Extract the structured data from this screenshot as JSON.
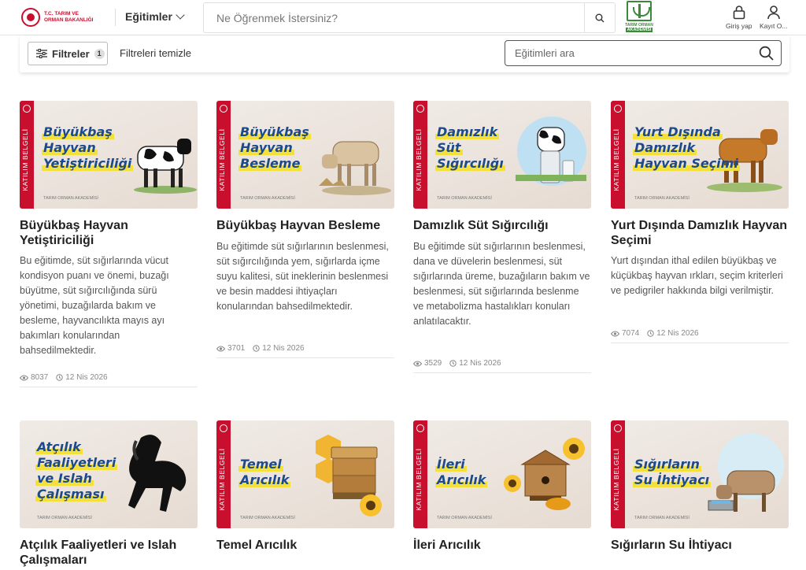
{
  "header": {
    "logo_text": "T.C. TARIM VE ORMAN BAKANLIĞI",
    "nav_label": "Eğitimler",
    "search_placeholder": "Ne Öğrenmek İstersiniz?",
    "akademi_line1": "TARIM ORMAN",
    "akademi_line2": "AKADEMİSİ",
    "login_label": "Giriş yap",
    "register_label": "Kayıt O..."
  },
  "filterbar": {
    "filter_label": "Filtreler",
    "filter_count": "1",
    "clear_label": "Filtreleri temizle",
    "search_placeholder": "Eğitimleri ara"
  },
  "thumb_common": {
    "ribbon": "KATILIM BELGELİ",
    "academy": "TARIM ORMAN AKADEMİSİ"
  },
  "cards": [
    {
      "thumb_lines": [
        "Büyükbaş",
        "Hayvan",
        "Yetiştiriciliği"
      ],
      "title": "Büyükbaş Hayvan Yetiştiriciliği",
      "description": "Bu eğitimde, süt sığırlarında vücut kondisyon puanı ve önemi, buzağı büyütme, süt sığırcılığında sürü yönetimi, buzağılarda bakım ve besleme, hayvancılıkta mayıs ayı bakımları konularından bahsedilmektedir.",
      "views": "8037",
      "date": "12 Nis 2026",
      "art": "cow-bw"
    },
    {
      "thumb_lines": [
        "Büyükbaş",
        "Hayvan",
        "Besleme"
      ],
      "title": "Büyükbaş Hayvan Besleme",
      "description": "Bu eğitimde süt sığırlarının beslenmesi, süt sığırcılığında yem, sığırlarda içme suyu kalitesi, süt ineklerinin beslenmesi ve besin maddesi ihtiyaçları konularından bahsedilmektedir.",
      "views": "3701",
      "date": "12 Nis 2026",
      "art": "cow-tan"
    },
    {
      "thumb_lines": [
        "Damızlık",
        "Süt",
        "Sığırcılığı"
      ],
      "title": "Damızlık Süt Sığırcılığı",
      "description": "Bu eğitimde süt sığırlarının beslenmesi, dana ve düvelerin beslenmesi, süt sığırlarında üreme, buzağıların bakım ve beslenmesi, süt sığırlarında beslenme ve metabolizma hastalıkları konuları anlatılacaktır.",
      "views": "3529",
      "date": "12 Nis 2026",
      "art": "cow-milk"
    },
    {
      "thumb_lines": [
        "Yurt Dışında",
        "Damızlık",
        "Hayvan Seçimi"
      ],
      "title": "Yurt Dışında Damızlık Hayvan Seçimi",
      "description": "Yurt dışından ithal edilen büyükbaş ve küçükbaş hayvan ırkları, seçim kriterleri ve pedigriler hakkında bilgi verilmiştir.",
      "views": "7074",
      "date": "12 Nis 2026",
      "art": "cow-brown"
    },
    {
      "thumb_lines": [
        "Atçılık",
        "Faaliyetleri",
        "ve Islah",
        "Çalışması"
      ],
      "title": "Atçılık Faaliyetleri ve Islah Çalışmaları",
      "description": "",
      "views": "",
      "date": "",
      "art": "horse"
    },
    {
      "thumb_lines": [
        "Temel",
        "Arıcılık"
      ],
      "title": "Temel Arıcılık",
      "description": "",
      "views": "",
      "date": "",
      "art": "hive"
    },
    {
      "thumb_lines": [
        "İleri",
        "Arıcılık"
      ],
      "title": "İleri Arıcılık",
      "description": "",
      "views": "",
      "date": "",
      "art": "hive2"
    },
    {
      "thumb_lines": [
        "Sığırların",
        "Su İhtiyacı"
      ],
      "title": "Sığırların Su İhtiyacı",
      "description": "",
      "views": "",
      "date": "",
      "art": "cow-water"
    }
  ]
}
